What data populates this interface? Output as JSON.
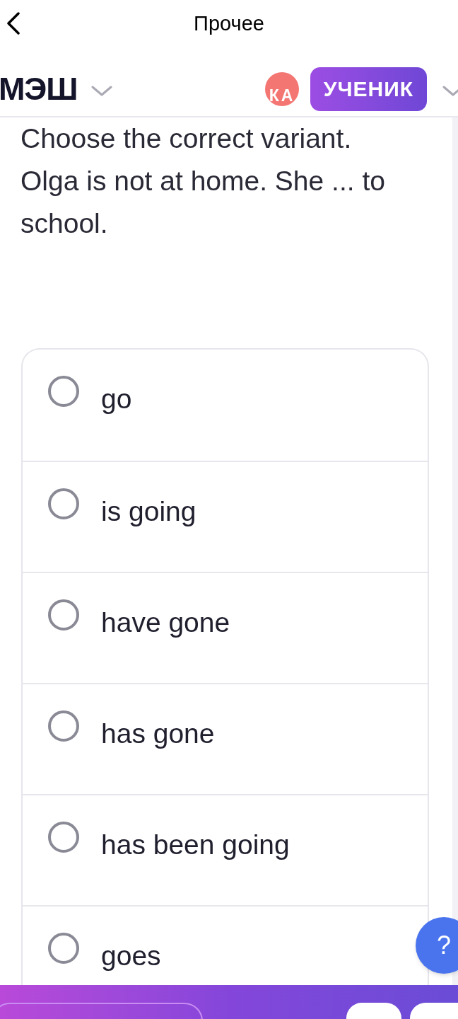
{
  "header": {
    "title": "Прочее"
  },
  "app_bar": {
    "logo": "МЭШ",
    "avatar": "КА",
    "role": "УЧЕНИК"
  },
  "question": {
    "instruction": "Choose the correct variant.",
    "text": "Olga is not at home. She ... to school."
  },
  "options": [
    {
      "label": "go",
      "selected": false
    },
    {
      "label": "is going",
      "selected": false
    },
    {
      "label": "have gone",
      "selected": false
    },
    {
      "label": "has gone",
      "selected": false
    },
    {
      "label": "has been going",
      "selected": false
    },
    {
      "label": "goes",
      "selected": false
    }
  ],
  "help_button": {
    "label": "?"
  }
}
